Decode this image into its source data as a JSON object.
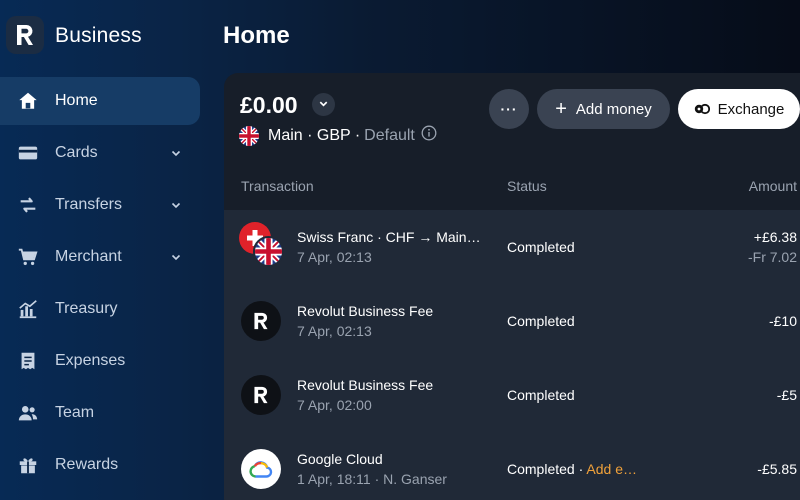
{
  "app": {
    "brand": "Business"
  },
  "sidebar": {
    "items": [
      {
        "label": "Home",
        "icon": "home-icon",
        "active": true
      },
      {
        "label": "Cards",
        "icon": "card-icon",
        "expandable": true
      },
      {
        "label": "Transfers",
        "icon": "transfer-arrows-icon",
        "expandable": true
      },
      {
        "label": "Merchant",
        "icon": "cart-icon",
        "expandable": true
      },
      {
        "label": "Treasury",
        "icon": "chart-bars-icon"
      },
      {
        "label": "Expenses",
        "icon": "receipt-icon"
      },
      {
        "label": "Team",
        "icon": "people-icon"
      },
      {
        "label": "Rewards",
        "icon": "gift-icon"
      }
    ]
  },
  "header": {
    "title": "Home"
  },
  "account": {
    "balance": "£0.00",
    "flag": "uk-flag-icon",
    "name_line": "Main · GBP ·",
    "default_label": "Default"
  },
  "actions": {
    "more_label": "···",
    "add_money_label": "Add money",
    "exchange_label": "Exchange"
  },
  "table": {
    "headers": {
      "transaction": "Transaction",
      "status": "Status",
      "amount": "Amount"
    },
    "rows": [
      {
        "name": "Swiss Franc · CHF → Main · GBP",
        "date": "7 Apr, 02:13",
        "status": "Completed",
        "amount": "+£6.38",
        "amount_secondary": "-Fr 7.02",
        "avatar": "chf-gbp-flags-icon"
      },
      {
        "name": "Revolut Business Fee",
        "date": "7 Apr, 02:13",
        "status": "Completed",
        "amount": "-£10",
        "avatar": "revolut-logo-icon"
      },
      {
        "name": "Revolut Business Fee",
        "date": "7 Apr, 02:00",
        "status": "Completed",
        "amount": "-£5",
        "avatar": "revolut-logo-icon"
      },
      {
        "name": "Google Cloud",
        "date": "1 Apr, 18:11 · N. Ganser",
        "status": "Completed ·",
        "status_action": "Add e…",
        "amount": "-£5.85",
        "avatar": "google-cloud-logo-icon"
      }
    ]
  },
  "colors": {
    "accent_attention": "#f0a13a",
    "card_bg": "#171e29",
    "row_bg": "#202937",
    "active_nav_bg": "#163c66"
  }
}
